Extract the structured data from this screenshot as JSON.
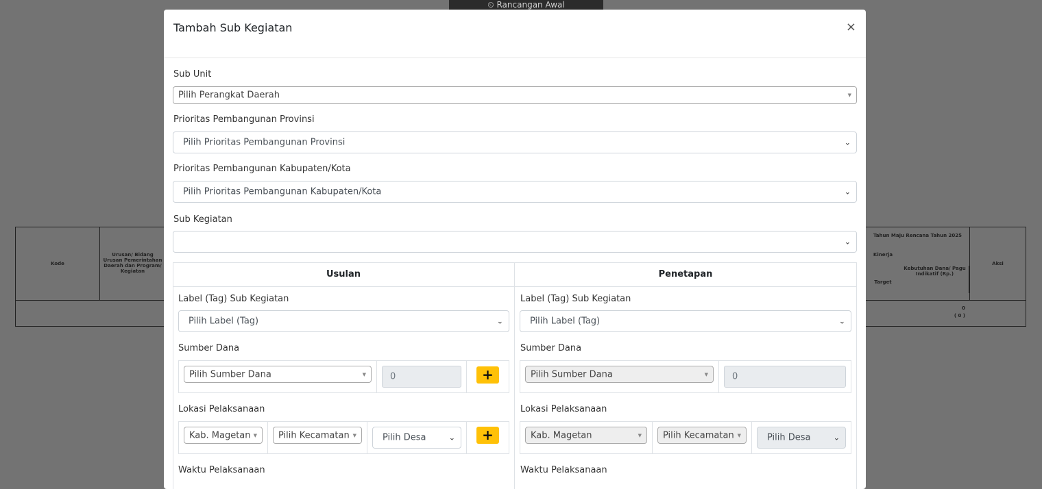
{
  "background": {
    "top_label": "Rancangan Awal",
    "table": {
      "col_kode": "Kode",
      "col_urusan": "Urusan/ Bidang Urusan Pemerintahan Daerah dan Program/ Kegiatan",
      "col_tahun": "Tahun Maju Rencana Tahun 2025",
      "col_kinerja": "Kinerja",
      "col_target": "Target",
      "col_kebutuhan": "Kebutuhan Dana/ Pagu Indikatif (Rp.)",
      "col_aksi": "Aksi",
      "row_value": "0",
      "row_value_sub": "( 0 )"
    }
  },
  "modal": {
    "title": "Tambah Sub Kegiatan",
    "close": "×",
    "sub_unit": {
      "label": "Sub Unit",
      "value": "Pilih Perangkat Daerah"
    },
    "prioritas_provinsi": {
      "label": "Prioritas Pembangunan Provinsi",
      "value": "Pilih Prioritas Pembangunan Provinsi"
    },
    "prioritas_kabkota": {
      "label": "Prioritas Pembangunan Kabupaten/Kota",
      "value": "Pilih Prioritas Pembangunan Kabupaten/Kota"
    },
    "sub_kegiatan": {
      "label": "Sub Kegiatan",
      "value": ""
    },
    "usulan": {
      "heading": "Usulan",
      "label_tag": {
        "label": "Label (Tag) Sub Kegiatan",
        "value": "Pilih Label (Tag)"
      },
      "sumber_dana": {
        "label": "Sumber Dana",
        "select": "Pilih Sumber Dana",
        "amount": "0",
        "add": "+"
      },
      "lokasi": {
        "label": "Lokasi Pelaksanaan",
        "kab": "Kab. Magetan",
        "kecamatan": "Pilih Kecamatan",
        "desa": "Pilih Desa",
        "add": "+"
      },
      "waktu": {
        "label": "Waktu Pelaksanaan"
      }
    },
    "penetapan": {
      "heading": "Penetapan",
      "label_tag": {
        "label": "Label (Tag) Sub Kegiatan",
        "value": "Pilih Label (Tag)"
      },
      "sumber_dana": {
        "label": "Sumber Dana",
        "select": "Pilih Sumber Dana",
        "amount": "0"
      },
      "lokasi": {
        "label": "Lokasi Pelaksanaan",
        "kab": "Kab. Magetan",
        "kecamatan": "Pilih Kecamatan",
        "desa": "Pilih Desa"
      },
      "waktu": {
        "label": "Waktu Pelaksanaan"
      }
    }
  },
  "colors": {
    "overlay": "#737373",
    "accent_button": "#ffc107"
  }
}
